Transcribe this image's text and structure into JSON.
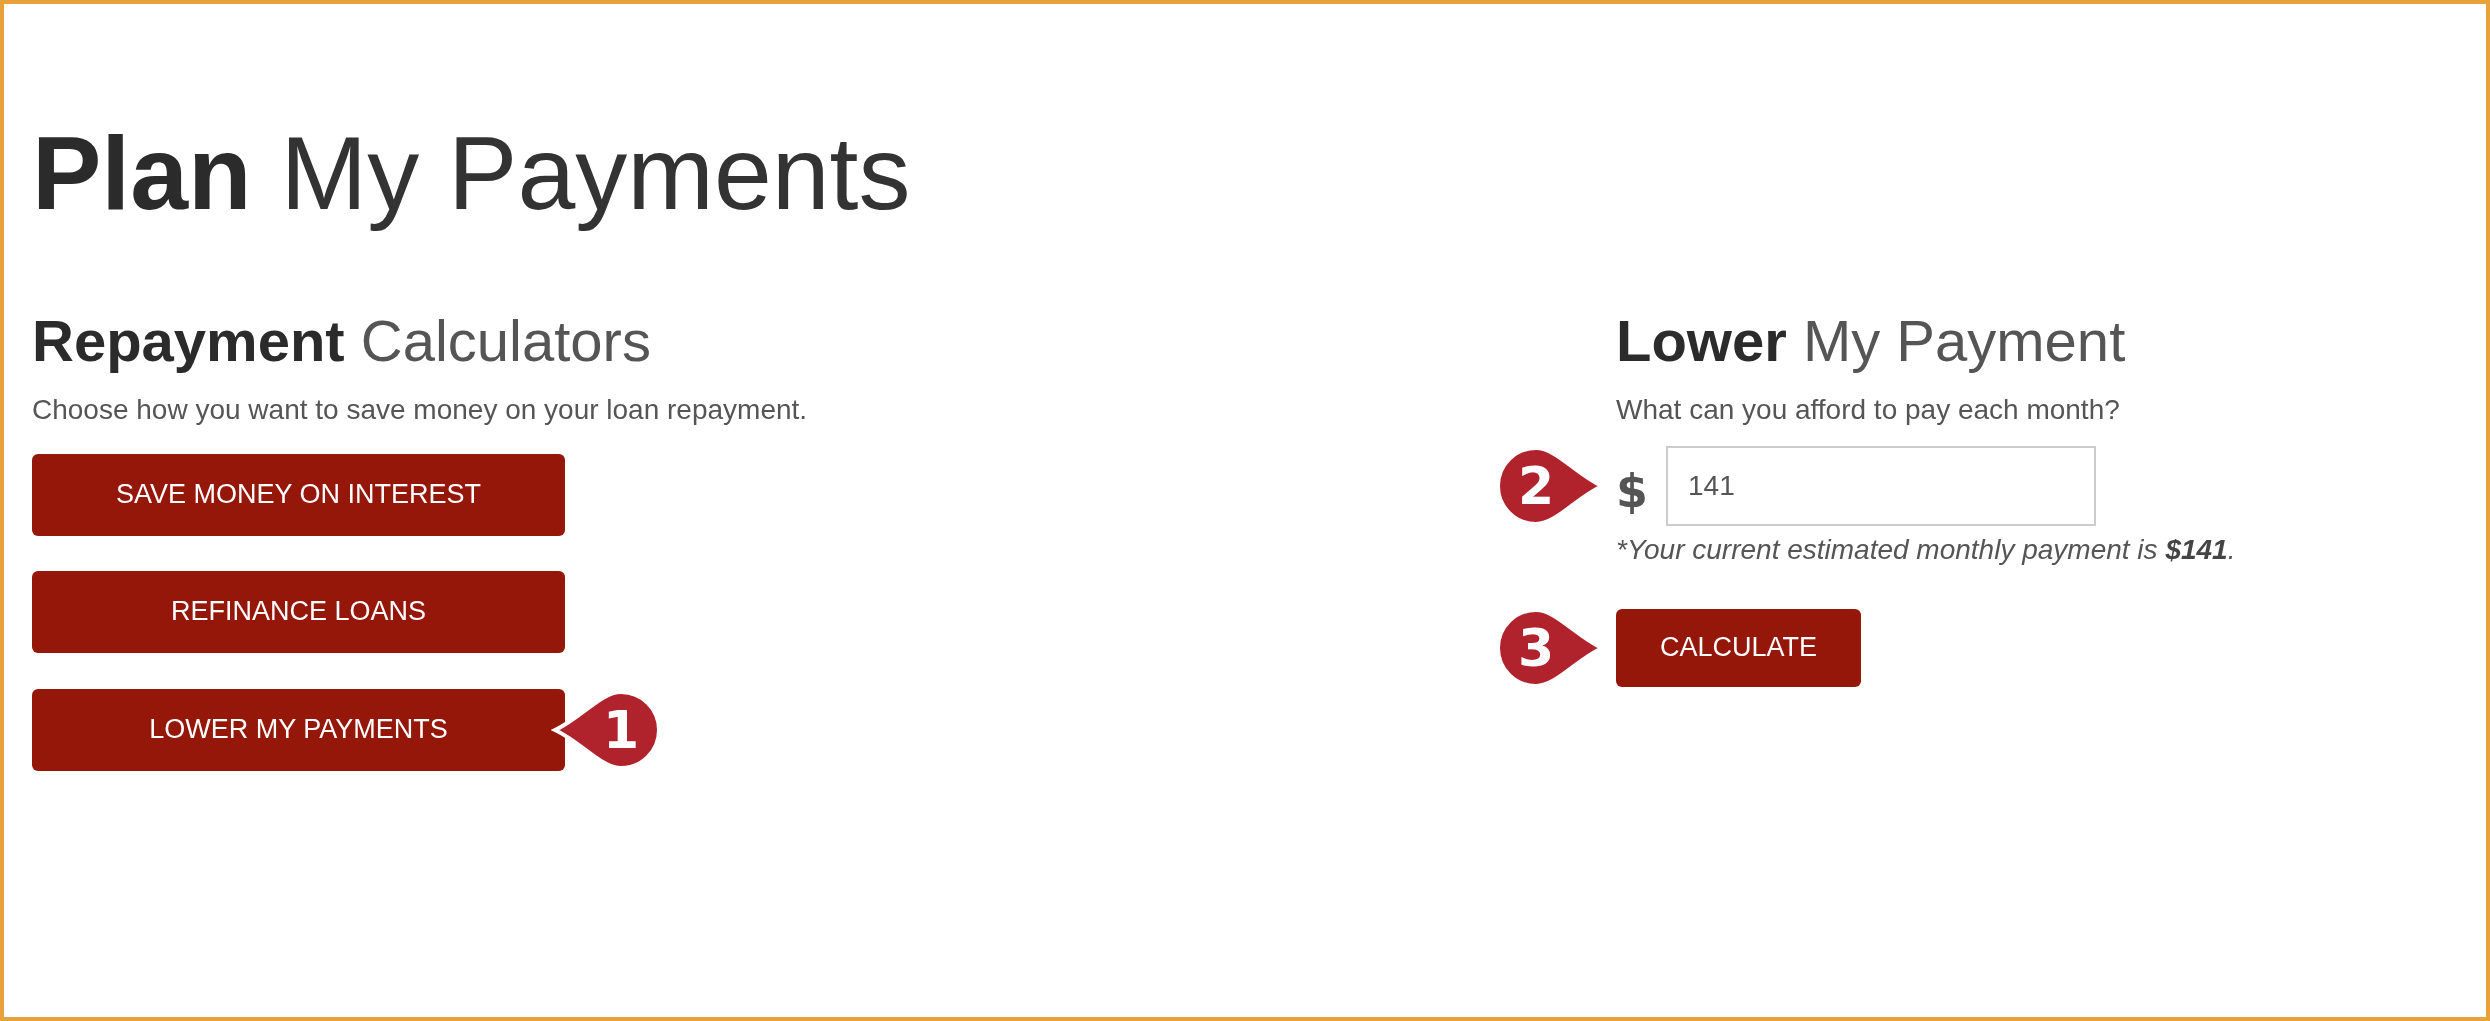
{
  "title": "**Plan** My Payments",
  "repayment": {
    "heading": "**Repayment** Calculators",
    "description": "Choose how you want to save money on your loan repayment.",
    "buttons": [
      {
        "label": "SAVE MONEY ON INTEREST"
      },
      {
        "label": "REFINANCE LOANS"
      },
      {
        "label": "LOWER MY PAYMENTS",
        "callout": "1"
      }
    ]
  },
  "lower": {
    "heading": "**Lower** My Payment",
    "question": "What can you afford to pay each month?",
    "field": {
      "prefix": "$",
      "value": "141",
      "callout": "2"
    },
    "note": "*Your current estimated monthly payment is **$141**.",
    "button": {
      "label": "CALCULATE",
      "callout": "3"
    }
  }
}
